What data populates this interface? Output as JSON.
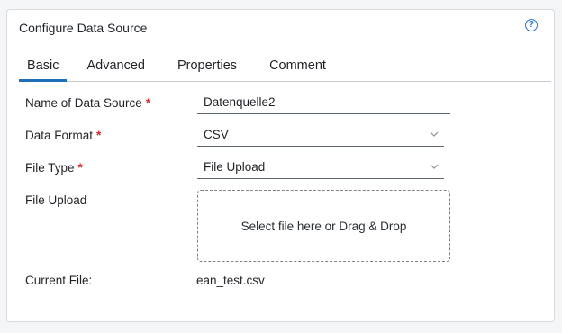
{
  "header": {
    "title": "Configure Data Source",
    "help_glyph": "?"
  },
  "tabs": [
    {
      "label": "Basic",
      "active": true
    },
    {
      "label": "Advanced",
      "active": false
    },
    {
      "label": "Properties",
      "active": false
    },
    {
      "label": "Comment",
      "active": false
    }
  ],
  "form": {
    "required_mark": "*",
    "name": {
      "label": "Name of Data Source",
      "value": "Datenquelle2"
    },
    "data_format": {
      "label": "Data Format",
      "value": "CSV"
    },
    "file_type": {
      "label": "File Type",
      "value": "File Upload"
    },
    "file_upload": {
      "label": "File Upload",
      "dropzone_text": "Select file here or Drag & Drop"
    },
    "current_file": {
      "label": "Current File:",
      "value": "ean_test.csv"
    }
  },
  "icons": {
    "help": "help-circle-icon",
    "dropdown": "chevron-down-icon"
  },
  "colors": {
    "accent": "#1d6fb8",
    "required": "#d72b2b",
    "help": "#2d74c4"
  }
}
